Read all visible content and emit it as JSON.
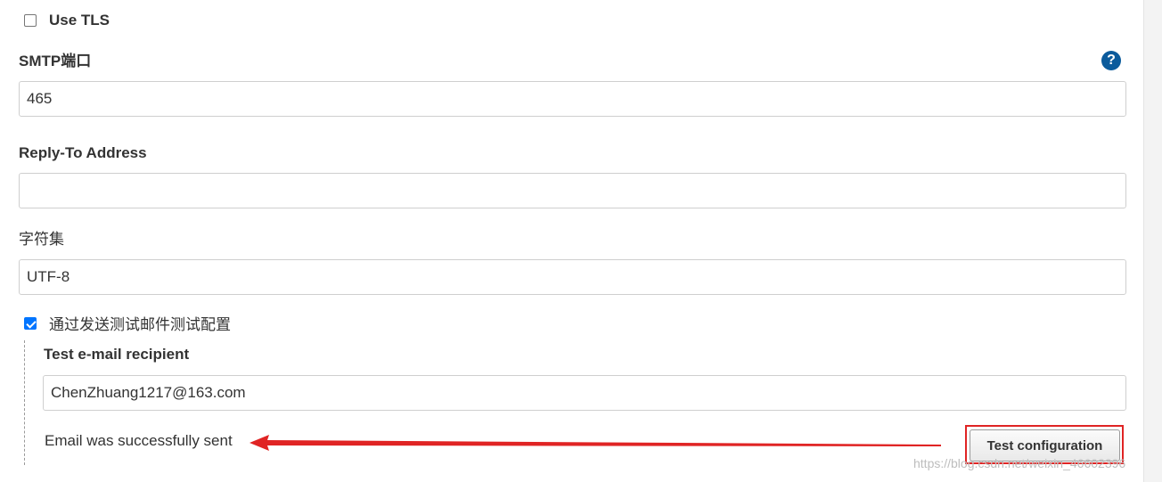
{
  "use_tls": {
    "label": "Use TLS",
    "checked": false
  },
  "smtp_port": {
    "label": "SMTP端口",
    "value": "465",
    "help_glyph": "?"
  },
  "reply_to": {
    "label": "Reply-To Address",
    "value": ""
  },
  "charset": {
    "label": "字符集",
    "value": "UTF-8"
  },
  "test_toggle": {
    "label": "通过发送测试邮件测试配置",
    "checked": true
  },
  "test_recipient": {
    "label": "Test e-mail recipient",
    "value": "ChenZhuang1217@163.com"
  },
  "status_message": "Email was successfully sent",
  "test_button_label": "Test configuration",
  "watermark": "https://blog.csdn.net/weixin_46602396",
  "colors": {
    "accent_checkbox": "#0075ff",
    "help_icon": "#0b5b9c",
    "annotation_red": "#e02424"
  }
}
